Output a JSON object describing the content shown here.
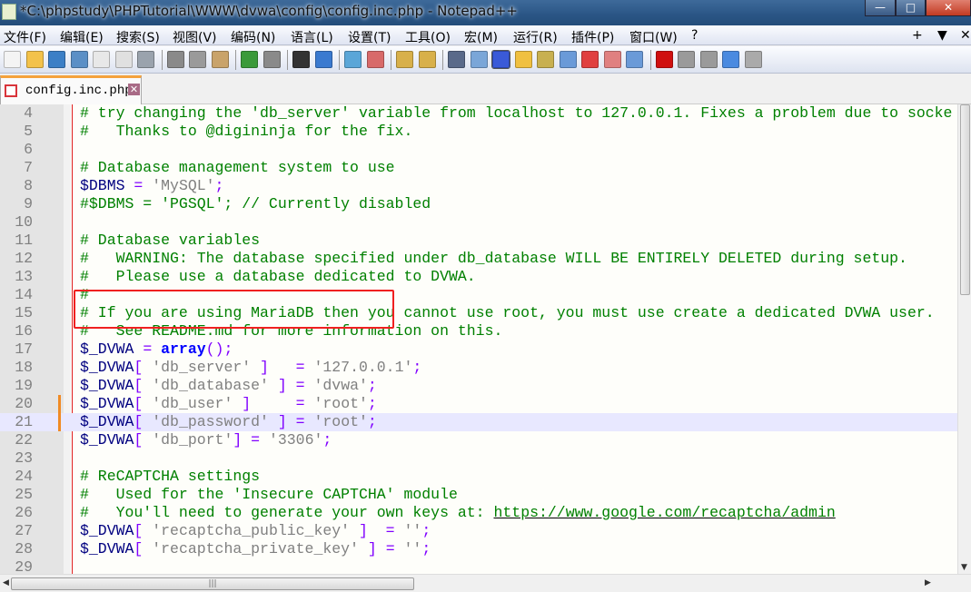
{
  "window": {
    "title": "*C:\\phpstudy\\PHPTutorial\\WWW\\dvwa\\config\\config.inc.php - Notepad++",
    "minimize": "—",
    "maximize": "□",
    "close": "✕"
  },
  "menu": {
    "items": [
      "文件(F)",
      "编辑(E)",
      "搜索(S)",
      "视图(V)",
      "编码(N)",
      "语言(L)",
      "设置(T)",
      "工具(O)",
      "宏(M)",
      "运行(R)",
      "插件(P)",
      "窗口(W)",
      "?"
    ],
    "right": [
      "+",
      "▼",
      "✕"
    ]
  },
  "toolbar": {
    "icons": [
      {
        "name": "new-file-icon",
        "color": "#f4f4f4"
      },
      {
        "name": "open-file-icon",
        "color": "#f3c24a"
      },
      {
        "name": "save-icon",
        "color": "#3c7fc6"
      },
      {
        "name": "save-all-icon",
        "color": "#5b8fc6"
      },
      {
        "name": "close-file-icon",
        "color": "#e8e8e8"
      },
      {
        "name": "close-all-icon",
        "color": "#e0e0e0"
      },
      {
        "name": "print-icon",
        "color": "#9aa3ad"
      },
      {
        "name": "cut-icon",
        "color": "#8a8a8a"
      },
      {
        "name": "copy-icon",
        "color": "#9a9a9a"
      },
      {
        "name": "paste-icon",
        "color": "#c9a36a"
      },
      {
        "name": "undo-icon",
        "color": "#3a9a3a"
      },
      {
        "name": "redo-icon",
        "color": "#8a8a8a"
      },
      {
        "name": "find-icon",
        "color": "#333333"
      },
      {
        "name": "replace-icon",
        "color": "#3a7ad0"
      },
      {
        "name": "zoom-in-icon",
        "color": "#5aa6d8"
      },
      {
        "name": "zoom-out-icon",
        "color": "#d86a6a"
      },
      {
        "name": "sync-vertical-icon",
        "color": "#d8b04a"
      },
      {
        "name": "sync-horizontal-icon",
        "color": "#d8b04a"
      },
      {
        "name": "word-wrap-icon",
        "color": "#5a6a8a"
      },
      {
        "name": "show-all-chars-icon",
        "color": "#7aa6d8"
      },
      {
        "name": "indent-guide-icon",
        "color": "#3a5ad8"
      },
      {
        "name": "user-language-icon",
        "color": "#f0c040"
      },
      {
        "name": "doc-map-icon",
        "color": "#c8b050"
      },
      {
        "name": "doc-list-icon",
        "color": "#6a9ad8"
      },
      {
        "name": "function-list-icon",
        "color": "#e04040"
      },
      {
        "name": "folder-workspace-icon",
        "color": "#e08080"
      },
      {
        "name": "monitoring-icon",
        "color": "#6a9ad8"
      },
      {
        "name": "macro-record-icon",
        "color": "#d01010"
      },
      {
        "name": "macro-stop-icon",
        "color": "#9a9a9a"
      },
      {
        "name": "macro-play-icon",
        "color": "#9a9a9a"
      },
      {
        "name": "macro-run-multiple-icon",
        "color": "#4a8ae0"
      },
      {
        "name": "macro-save-icon",
        "color": "#aaaaaa"
      }
    ]
  },
  "tab": {
    "label": "config.inc.php",
    "close": "✕"
  },
  "editor": {
    "current_line": 21,
    "changed_lines": [
      20,
      21
    ],
    "lines": [
      {
        "n": "4",
        "t": [
          [
            "comment",
            "# try changing the 'db_server' variable from localhost to 127.0.0.1. Fixes a problem due to socke"
          ]
        ]
      },
      {
        "n": "5",
        "t": [
          [
            "comment",
            "#   Thanks to @digininja for the fix."
          ]
        ]
      },
      {
        "n": "6",
        "t": []
      },
      {
        "n": "7",
        "t": [
          [
            "comment",
            "# Database management system to use"
          ]
        ]
      },
      {
        "n": "8",
        "t": [
          [
            "var",
            "$DBMS "
          ],
          [
            "op",
            "= "
          ],
          [
            "str",
            "'MySQL'"
          ],
          [
            "op",
            ";"
          ]
        ]
      },
      {
        "n": "9",
        "t": [
          [
            "comment",
            "#$DBMS = 'PGSQL'; // Currently disabled"
          ]
        ]
      },
      {
        "n": "10",
        "t": []
      },
      {
        "n": "11",
        "t": [
          [
            "comment",
            "# Database variables"
          ]
        ]
      },
      {
        "n": "12",
        "t": [
          [
            "comment",
            "#   WARNING: The database specified under db_database WILL BE ENTIRELY DELETED during setup."
          ]
        ]
      },
      {
        "n": "13",
        "t": [
          [
            "comment",
            "#   Please use a database dedicated to DVWA."
          ]
        ]
      },
      {
        "n": "14",
        "t": [
          [
            "comment",
            "#"
          ]
        ]
      },
      {
        "n": "15",
        "t": [
          [
            "comment",
            "# If you are using MariaDB then you cannot use root, you must use create a dedicated DVWA user."
          ]
        ]
      },
      {
        "n": "16",
        "t": [
          [
            "comment",
            "#   See README.md for more information on this."
          ]
        ]
      },
      {
        "n": "17",
        "t": [
          [
            "var",
            "$_DVWA "
          ],
          [
            "op",
            "= "
          ],
          [
            "kw",
            "array"
          ],
          [
            "op",
            "();"
          ]
        ]
      },
      {
        "n": "18",
        "t": [
          [
            "var",
            "$_DVWA"
          ],
          [
            "op",
            "[ "
          ],
          [
            "str",
            "'db_server'"
          ],
          [
            "op",
            " ]   = "
          ],
          [
            "str",
            "'127.0.0.1'"
          ],
          [
            "op",
            ";"
          ]
        ]
      },
      {
        "n": "19",
        "t": [
          [
            "var",
            "$_DVWA"
          ],
          [
            "op",
            "[ "
          ],
          [
            "str",
            "'db_database'"
          ],
          [
            "op",
            " ] = "
          ],
          [
            "str",
            "'dvwa'"
          ],
          [
            "op",
            ";"
          ]
        ]
      },
      {
        "n": "20",
        "t": [
          [
            "var",
            "$_DVWA"
          ],
          [
            "op",
            "[ "
          ],
          [
            "str",
            "'db_user'"
          ],
          [
            "op",
            " ]     = "
          ],
          [
            "str",
            "'root'"
          ],
          [
            "op",
            ";"
          ]
        ]
      },
      {
        "n": "21",
        "t": [
          [
            "var",
            "$_DVWA"
          ],
          [
            "op",
            "[ "
          ],
          [
            "str",
            "'db_password'"
          ],
          [
            "op",
            " ] = "
          ],
          [
            "str",
            "'root'"
          ],
          [
            "op",
            ";"
          ]
        ]
      },
      {
        "n": "22",
        "t": [
          [
            "var",
            "$_DVWA"
          ],
          [
            "op",
            "[ "
          ],
          [
            "str",
            "'db_port'"
          ],
          [
            "op",
            "] = "
          ],
          [
            "str",
            "'3306'"
          ],
          [
            "op",
            ";"
          ]
        ]
      },
      {
        "n": "23",
        "t": []
      },
      {
        "n": "24",
        "t": [
          [
            "comment",
            "# ReCAPTCHA settings"
          ]
        ]
      },
      {
        "n": "25",
        "t": [
          [
            "comment",
            "#   Used for the 'Insecure CAPTCHA' module"
          ]
        ]
      },
      {
        "n": "26",
        "t": [
          [
            "comment",
            "#   You'll need to generate your own keys at: "
          ],
          [
            "url",
            "https://www.google.com/recaptcha/admin"
          ]
        ]
      },
      {
        "n": "27",
        "t": [
          [
            "var",
            "$_DVWA"
          ],
          [
            "op",
            "[ "
          ],
          [
            "str",
            "'recaptcha_public_key'"
          ],
          [
            "op",
            " ]  = "
          ],
          [
            "str",
            "''"
          ],
          [
            "op",
            ";"
          ]
        ]
      },
      {
        "n": "28",
        "t": [
          [
            "var",
            "$_DVWA"
          ],
          [
            "op",
            "[ "
          ],
          [
            "str",
            "'recaptcha_private_key'"
          ],
          [
            "op",
            " ] = "
          ],
          [
            "str",
            "''"
          ],
          [
            "op",
            ";"
          ]
        ]
      },
      {
        "n": "29",
        "t": []
      }
    ]
  }
}
